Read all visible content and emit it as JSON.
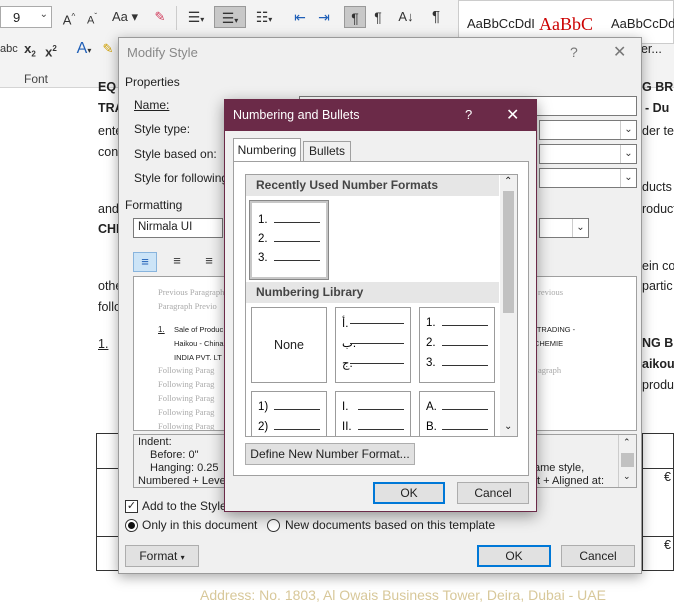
{
  "ribbon": {
    "font_size": "9",
    "grow_font": "A",
    "shrink_font": "A",
    "change_case": "Aa",
    "subscript": "x",
    "superscript": "x",
    "group_font_label": "Font",
    "styles": [
      "AaBbCcDdI",
      "AaBbC",
      "AaBbCcDdI"
    ],
    "style_partial": "der..."
  },
  "doc": {
    "lines": [
      {
        "text": "EQ"
      },
      {
        "text": "TRA"
      },
      {
        "text": "ente"
      },
      {
        "text": "con"
      },
      {
        "text": "and"
      },
      {
        "text": "CHI"
      },
      {
        "text": "othe"
      },
      {
        "text": "follo"
      },
      {
        "text": "1."
      }
    ],
    "right_lines": [
      "G BRI",
      "- Du",
      "der te",
      "ducts",
      "roduct",
      "ein co",
      "partic",
      "NG BI",
      "aikou",
      "produ"
    ],
    "euro1": "€",
    "euro2": "€",
    "footer": "Address: No. 1803, Al Owais Business Tower, Deira, Dubai - UAE"
  },
  "modify": {
    "title": "Modify Style",
    "help": "?",
    "close": "✕",
    "properties": "Properties",
    "name_label": "Name:",
    "style_type_label": "Style type:",
    "style_based_label": "Style based on:",
    "style_following_label": "Style for following",
    "formatting": "Formatting",
    "font_value": "Nirmala UI",
    "preview": {
      "previous1": "Previous Paragraph",
      "previous2": "Paragraph Previo",
      "previous_right": "revious",
      "item_num": "1.",
      "item_text1": "Sale of Produc",
      "item_text1_right": "AL TRADING -",
      "item_text2": "Haikou - China",
      "item_text2_right": "D-CHEMIE",
      "item_text3": "INDIA PVT. LT",
      "following": [
        "Following Parag",
        "Following Parag",
        "Following Parag",
        "Following Parag",
        "Following Parag",
        "Following Parag"
      ],
      "following_right": "agraph"
    },
    "desc": {
      "line1": "Indent:",
      "line2": "Before:  0\"",
      "line3": "Hanging:  0.25",
      "line4": "Numbered + Leve",
      "line3_right": "ame style,",
      "line4_right": "ft + Aligned at:"
    },
    "add_gallery": "Add to the Style",
    "only_doc": "Only in this document",
    "new_docs": "New documents based on this template",
    "format_btn": "Format",
    "ok": "OK",
    "cancel": "Cancel"
  },
  "numbering": {
    "title": "Numbering and Bullets",
    "help": "?",
    "close": "✕",
    "tabs": [
      "Numbering",
      "Bullets"
    ],
    "recent_header": "Recently Used Number Formats",
    "library_header": "Numbering Library",
    "recent_tile": [
      "1.",
      "2.",
      "3."
    ],
    "tiles": [
      {
        "name": "none",
        "label": "None"
      },
      {
        "name": "arabic-abjad",
        "items": [
          "أ.",
          "ب.",
          "ج."
        ]
      },
      {
        "name": "decimal",
        "items": [
          "1.",
          "2.",
          "3."
        ]
      },
      {
        "name": "decimal-paren",
        "items": [
          "1)",
          "2)"
        ]
      },
      {
        "name": "roman",
        "items": [
          "I.",
          "II."
        ]
      },
      {
        "name": "upper-alpha",
        "items": [
          "A.",
          "B."
        ]
      }
    ],
    "define_btn": "Define New Number Format...",
    "ok": "OK",
    "cancel": "Cancel"
  }
}
